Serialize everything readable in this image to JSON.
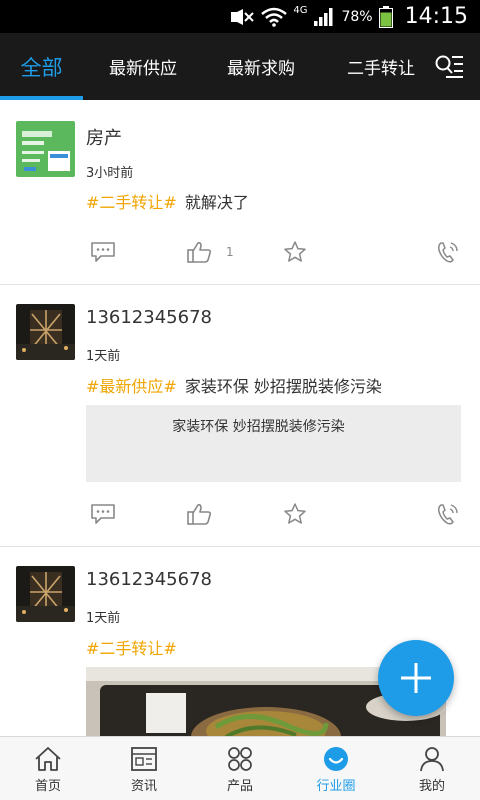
{
  "status_bar": {
    "network": "4G",
    "battery": "78%",
    "time": "14:15"
  },
  "tabs": [
    {
      "label": "全部",
      "active": true
    },
    {
      "label": "最新供应",
      "active": false
    },
    {
      "label": "最新求购",
      "active": false
    },
    {
      "label": "二手转让",
      "active": false
    }
  ],
  "posts": [
    {
      "author": "房产",
      "time": "3小时前",
      "tag": "#二手转让#",
      "text": "就解决了",
      "like_count": "1"
    },
    {
      "author": "13612345678",
      "time": "1天前",
      "tag": "#最新供应#",
      "text": "家装环保 妙招摆脱装修污染",
      "link_card_title": "家装环保 妙招摆脱装修污染"
    },
    {
      "author": "13612345678",
      "time": "1天前",
      "tag": "#二手转让#",
      "text": ""
    }
  ],
  "bottom_nav": [
    {
      "label": "首页",
      "icon": "home-icon",
      "active": false
    },
    {
      "label": "资讯",
      "icon": "news-icon",
      "active": false
    },
    {
      "label": "产品",
      "icon": "products-icon",
      "active": false
    },
    {
      "label": "行业圈",
      "icon": "industry-circle-icon",
      "active": true
    },
    {
      "label": "我的",
      "icon": "profile-icon",
      "active": false
    }
  ],
  "colors": {
    "accent": "#1e9ce8",
    "tag": "#f0a500",
    "tab_bar": "#1a1a1a"
  }
}
